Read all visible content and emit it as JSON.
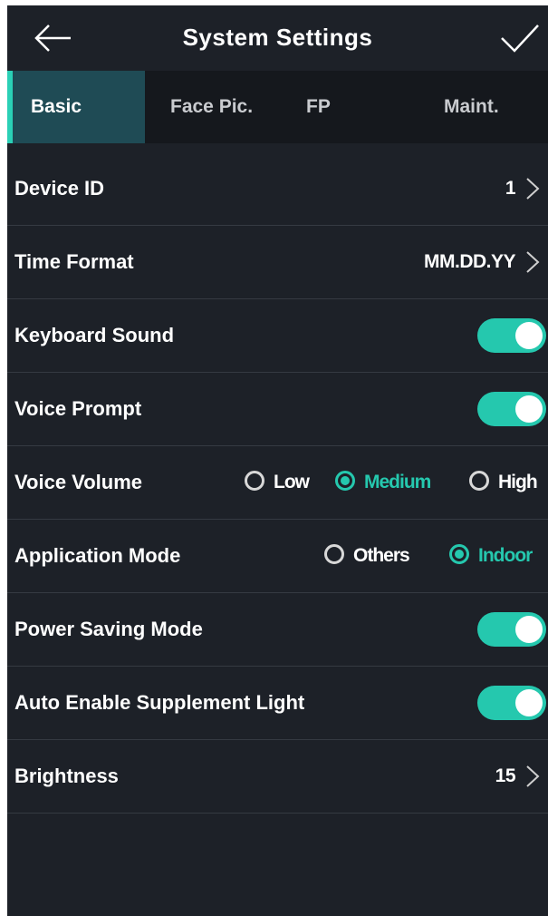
{
  "header": {
    "title": "System Settings",
    "back_icon": "arrow-left-icon",
    "confirm_icon": "checkmark-icon"
  },
  "tabs": [
    {
      "label": "Basic",
      "active": true
    },
    {
      "label": "Face Pic.",
      "active": false
    },
    {
      "label": "FP",
      "active": false
    },
    {
      "label": "Maint.",
      "active": false
    }
  ],
  "settings": {
    "device_id": {
      "label": "Device ID",
      "value": "1"
    },
    "time_format": {
      "label": "Time Format",
      "value": "MM.DD.YY"
    },
    "keyboard_sound": {
      "label": "Keyboard Sound",
      "enabled": true
    },
    "voice_prompt": {
      "label": "Voice Prompt",
      "enabled": true
    },
    "voice_volume": {
      "label": "Voice Volume",
      "options": [
        "Low",
        "Medium",
        "High"
      ],
      "selected": "Medium"
    },
    "application_mode": {
      "label": "Application Mode",
      "options": [
        "Others",
        "Indoor"
      ],
      "selected": "Indoor"
    },
    "power_saving_mode": {
      "label": "Power Saving Mode",
      "enabled": true
    },
    "auto_enable_supplement_light": {
      "label": "Auto Enable Supplement Light",
      "enabled": true
    },
    "brightness": {
      "label": "Brightness",
      "value": "15"
    }
  },
  "colors": {
    "accent": "#25c8ae",
    "background": "#1d2128",
    "tab_bar": "#15181d",
    "active_tab": "#1f4b55"
  }
}
